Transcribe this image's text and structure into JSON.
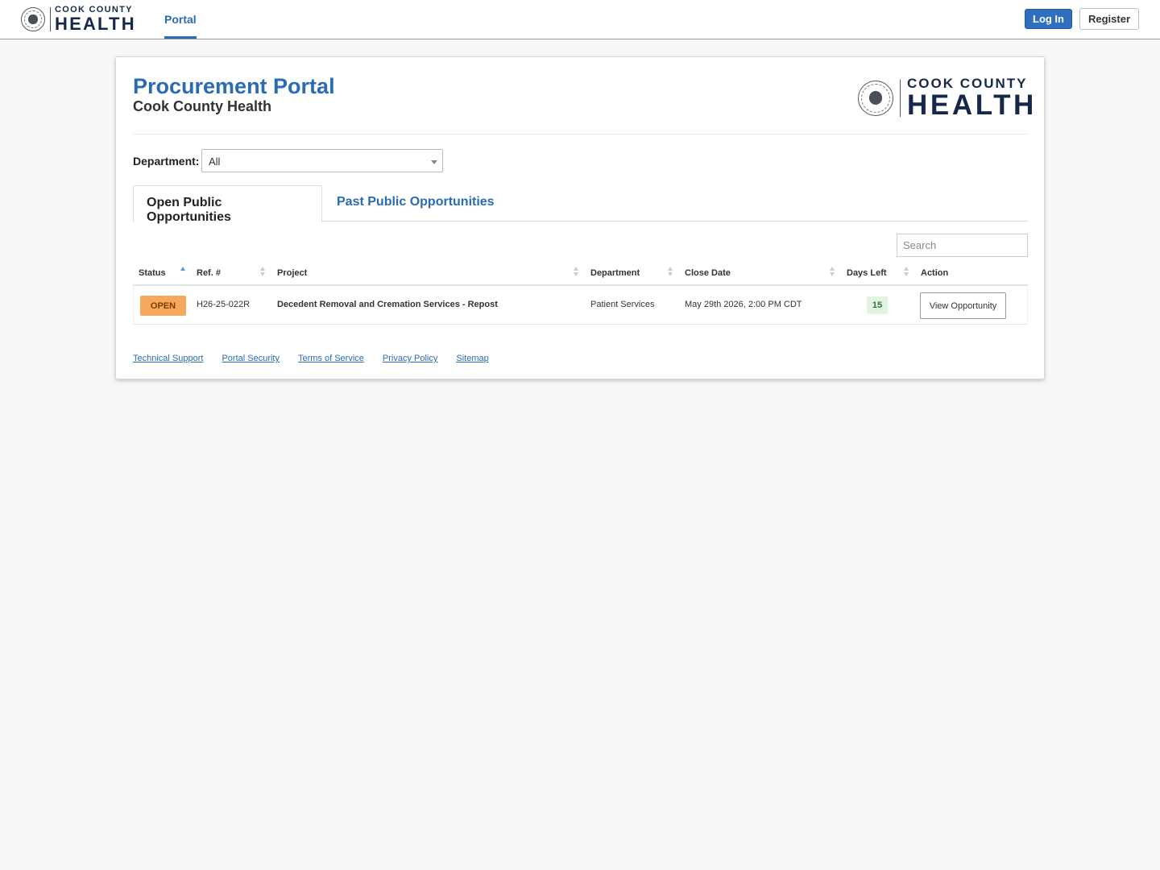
{
  "navbar": {
    "logo_line1": "COOK COUNTY",
    "logo_line2": "HEALTH",
    "portal_link": "Portal",
    "login_label": "Log In",
    "register_label": "Register"
  },
  "header": {
    "title": "Procurement Portal",
    "subtitle": "Cook County Health",
    "logo_line1": "COOK COUNTY",
    "logo_line2": "HEALTH"
  },
  "filter": {
    "label": "Department:",
    "selected": "All"
  },
  "tabs": [
    {
      "label": "Open Public Opportunities",
      "active": true
    },
    {
      "label": "Past Public Opportunities",
      "active": false
    }
  ],
  "search": {
    "placeholder": "Search"
  },
  "table": {
    "columns": [
      "Status",
      "Ref. #",
      "Project",
      "Department",
      "Close Date",
      "Days Left",
      "Action"
    ],
    "rows": [
      {
        "status": "OPEN",
        "ref": "H26-25-022R",
        "project": "Decedent Removal and Cremation Services - Repost",
        "department": "Patient Services",
        "close_date": "May 29th 2026, 2:00 PM CDT",
        "days_left": "15",
        "action": "View Opportunity"
      }
    ]
  },
  "footer": {
    "links": [
      "Technical Support",
      "Portal Security",
      "Terms of Service",
      "Privacy Policy",
      "Sitemap"
    ]
  },
  "colors": {
    "brand_blue": "#2a6bb4",
    "status_open": "#f6a95c",
    "days_left_bg": "#e3f3e3"
  }
}
